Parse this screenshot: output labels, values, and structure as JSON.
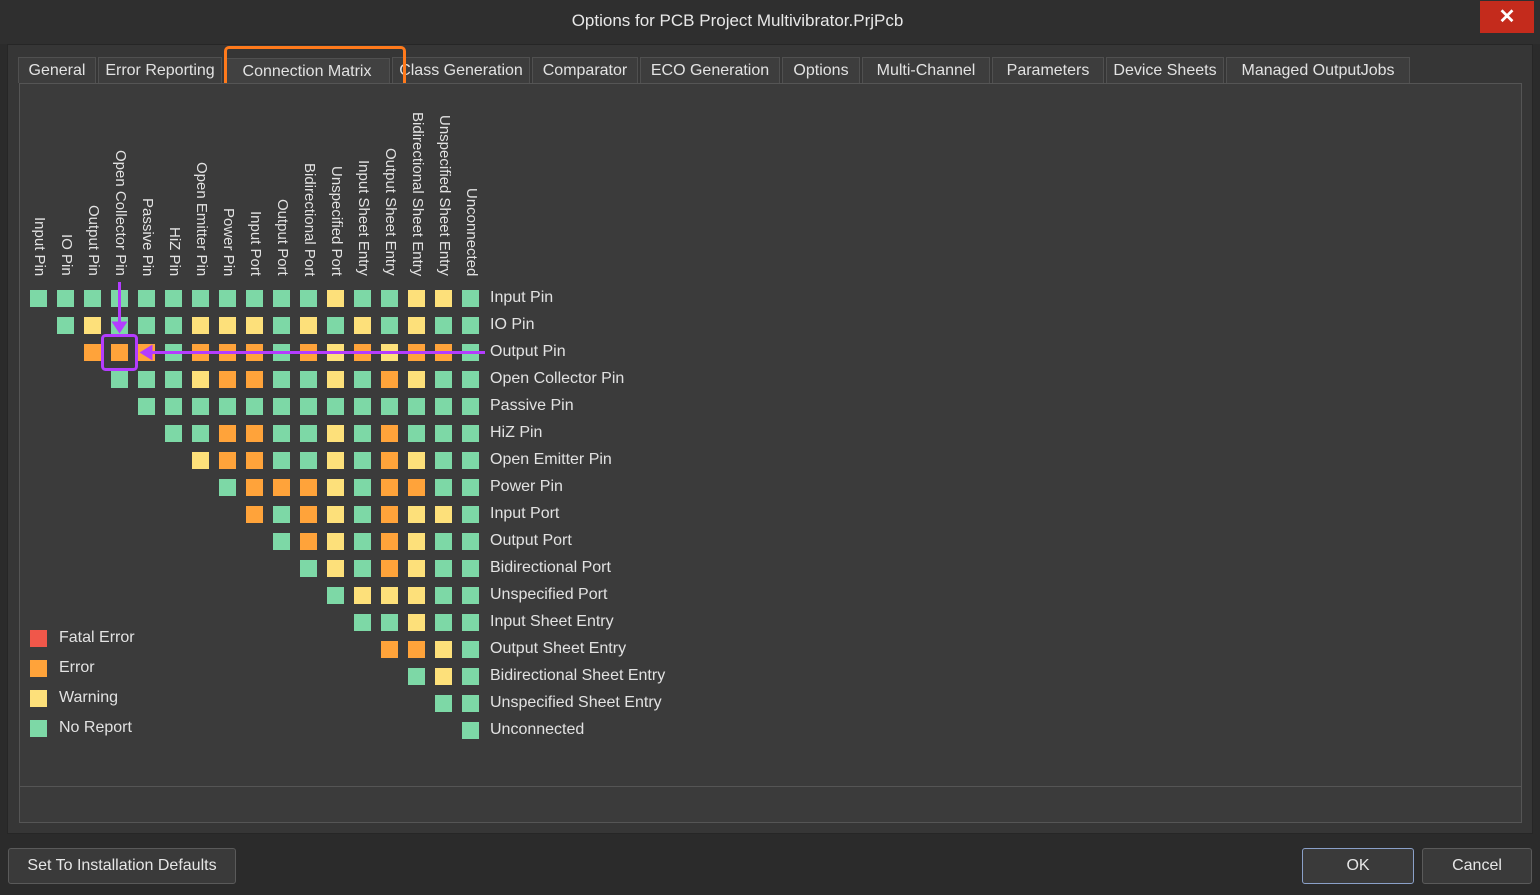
{
  "window": {
    "title": "Options for PCB Project Multivibrator.PrjPcb",
    "close_label": "✕"
  },
  "tabs": [
    {
      "label": "General"
    },
    {
      "label": "Error Reporting"
    },
    {
      "label": "Connection Matrix",
      "active": true
    },
    {
      "label": "Class Generation"
    },
    {
      "label": "Comparator"
    },
    {
      "label": "ECO Generation"
    },
    {
      "label": "Options"
    },
    {
      "label": "Multi-Channel"
    },
    {
      "label": "Parameters"
    },
    {
      "label": "Device Sheets"
    },
    {
      "label": "Managed OutputJobs"
    }
  ],
  "matrix": {
    "labels": [
      "Input Pin",
      "IO Pin",
      "Output Pin",
      "Open Collector Pin",
      "Passive Pin",
      "HiZ Pin",
      "Open Emitter Pin",
      "Power Pin",
      "Input Port",
      "Output Port",
      "Bidirectional Port",
      "Unspecified Port",
      "Input Sheet Entry",
      "Output Sheet Entry",
      "Bidirectional Sheet Entry",
      "Unspecified Sheet Entry",
      "Unconnected"
    ],
    "rows": [
      "NNNNNNNNNNNWNNWW",
      "NWNNNWWWNWNWNWN",
      "EEENEEENEWEWEEN",
      "NNNWEENNWNEWN",
      "NNNNNNNNNNNN",
      "NNEENNWNENN",
      "WEENNWNEWN",
      "NEEEWNEENN",
      "ENEWNEWW",
      "NEWNEWN",
      "NWNEWN",
      "NWWWN",
      "NNWN",
      "EEW",
      "NW",
      "N",
      ""
    ],
    "highlighted_cell": {
      "row": "Output Pin",
      "column": "Open Collector Pin",
      "level": "Error"
    }
  },
  "colors": {
    "fatal_error": "#f0574a",
    "error": "#ffa33a",
    "warning": "#fde07a",
    "no_report": "#7dd8a6",
    "annotation": "#b43cff",
    "tab_highlight": "#ff7a1c"
  },
  "legend": [
    {
      "key": "fatal_error",
      "label": "Fatal Error"
    },
    {
      "key": "error",
      "label": "Error"
    },
    {
      "key": "warning",
      "label": "Warning"
    },
    {
      "key": "no_report",
      "label": "No Report"
    }
  ],
  "buttons": {
    "defaults": "Set To Installation Defaults",
    "ok": "OK",
    "cancel": "Cancel"
  }
}
